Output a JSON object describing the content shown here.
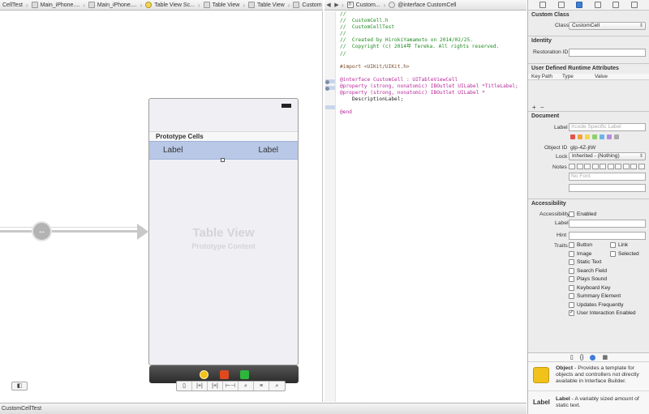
{
  "jumpbar_left": {
    "crumbs": [
      {
        "label": "CellTest",
        "icon": "project-icon"
      },
      {
        "label": "Main_iPhone....",
        "icon": "storyboard-icon"
      },
      {
        "label": "Main_iPhone....",
        "icon": "storyboard-icon"
      },
      {
        "label": "Table View Sc...",
        "icon": "scene-icon"
      },
      {
        "label": "Table View",
        "icon": "table-view-icon"
      },
      {
        "label": "Table View",
        "icon": "table-view-icon"
      },
      {
        "label": "Custom Cell – Cell",
        "icon": "cell-icon"
      }
    ]
  },
  "jumpbar_right": {
    "back": "◀",
    "forward": "▶",
    "crumbs": [
      {
        "label": "Custom...",
        "icon": "header-file-icon"
      },
      {
        "label": "@interface CustomCell",
        "icon": "class-icon"
      }
    ]
  },
  "canvas": {
    "prototype_cells": "Prototype Cells",
    "cell_label_left": "Label",
    "cell_label_right": "Label",
    "table_view_title": "Table View",
    "table_view_subtitle": "Prototype Content"
  },
  "layout_buttons": [
    "▯",
    "|+|",
    "|+|",
    "⊢⊣",
    "⌕",
    "≡",
    "⌕"
  ],
  "status_bar": {
    "text": "CustomCellTest"
  },
  "code": [
    {
      "t": "//",
      "c": "cmt"
    },
    {
      "t": "//  CustomCell.h",
      "c": "cmt"
    },
    {
      "t": "//  CustomCellTest",
      "c": "cmt"
    },
    {
      "t": "//",
      "c": "cmt"
    },
    {
      "t": "//  Created by HirokiYamamoto on 2014/02/25.",
      "c": "cmt"
    },
    {
      "t": "//  Copyright (c) 2014年 Tereka. All rights reserved.",
      "c": "cmt"
    },
    {
      "t": "//",
      "c": "cmt"
    },
    {
      "t": "",
      "c": "pl"
    },
    {
      "t": "#import <UIKit/UIKit.h>",
      "c": "pp"
    },
    {
      "t": "",
      "c": "pl"
    },
    {
      "t": "@interface CustomCell : UITableViewCell",
      "c": "kw"
    },
    {
      "t": "@property (strong, nonatomic) IBOutlet UILabel *TitleLabel;",
      "c": "kw"
    },
    {
      "t": "@property (strong, nonatomic) IBOutlet UILabel *",
      "c": "kw"
    },
    {
      "t": "    DescriptionLabel;",
      "c": "pl"
    },
    {
      "t": "",
      "c": "pl"
    },
    {
      "t": "@end",
      "c": "kw"
    }
  ],
  "inspector": {
    "custom_class": {
      "header": "Custom Class",
      "class_label": "Class",
      "class_value": "CustomCell"
    },
    "identity": {
      "header": "Identity",
      "restoration_label": "Restoration ID"
    },
    "runtime_attrs": {
      "header": "User Defined Runtime Attributes",
      "columns": [
        "Key Path",
        "Type",
        "Value"
      ],
      "add": "+",
      "remove": "−"
    },
    "document": {
      "header": "Document",
      "label_label": "Label",
      "label_placeholder": "Xcode Specific Label",
      "object_id_label": "Object ID",
      "object_id_value": "glp-4Z-jtW",
      "lock_label": "Lock",
      "lock_value": "Inherited - (Nothing)",
      "notes_label": "Notes",
      "font_placeholder": "No Font",
      "swatches": [
        "#e2544a",
        "#f2a33a",
        "#f4d84a",
        "#8fd06a",
        "#6cb4e8",
        "#b58be0",
        "#aaaaaa"
      ]
    },
    "accessibility": {
      "header": "Accessibility",
      "accessibility_label": "Accessibility",
      "enabled_label": "Enabled",
      "label_label": "Label",
      "hint_label": "Hint",
      "traits_label": "Traits",
      "traits": [
        {
          "label": "Button",
          "checked": false
        },
        {
          "label": "Link",
          "checked": false
        },
        {
          "label": "Image",
          "checked": false
        },
        {
          "label": "Selected",
          "checked": false
        },
        {
          "label": "Static Text",
          "checked": false
        },
        {
          "label": "Search Field",
          "checked": false
        },
        {
          "label": "Plays Sound",
          "checked": false
        },
        {
          "label": "Keyboard Key",
          "checked": false
        },
        {
          "label": "Summary Element",
          "checked": false
        },
        {
          "label": "Updates Frequently",
          "checked": false
        },
        {
          "label": "User Interaction Enabled",
          "checked": true
        }
      ]
    }
  },
  "library": {
    "items": [
      {
        "name": "Object",
        "desc": " - Provides a template for objects and controllers not directly available in Interface Builder."
      },
      {
        "name": "Label",
        "desc": " - A variably sized amount of static text."
      }
    ]
  }
}
